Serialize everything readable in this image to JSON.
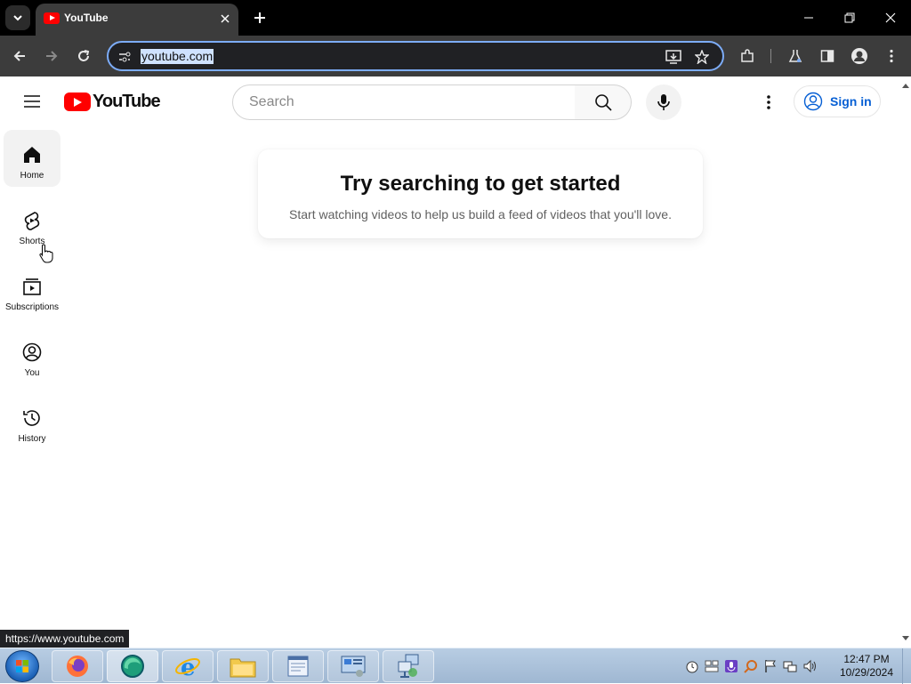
{
  "browser": {
    "tab_title": "YouTube",
    "address": "youtube.com",
    "status_url": "https://www.youtube.com"
  },
  "youtube": {
    "logo_text": "YouTube",
    "search_placeholder": "Search",
    "sign_in": "Sign in",
    "guide": [
      {
        "label": "Home",
        "icon": "home-icon",
        "active": true
      },
      {
        "label": "Shorts",
        "icon": "shorts-icon"
      },
      {
        "label": "Subscriptions",
        "icon": "subscriptions-icon"
      },
      {
        "label": "You",
        "icon": "you-icon"
      },
      {
        "label": "History",
        "icon": "history-icon"
      }
    ],
    "empty_title": "Try searching to get started",
    "empty_subtitle": "Start watching videos to help us build a feed of videos that you'll love."
  },
  "taskbar": {
    "time": "12:47 PM",
    "date": "10/29/2024",
    "apps": [
      "firefox-icon",
      "edge-icon",
      "internet-explorer-icon",
      "file-explorer-icon",
      "document-viewer-icon",
      "control-panel-icon",
      "network-icon"
    ]
  },
  "colors": {
    "accent": "#ff0000",
    "link": "#065fd4",
    "omnibox_focus": "#7cacf8"
  }
}
